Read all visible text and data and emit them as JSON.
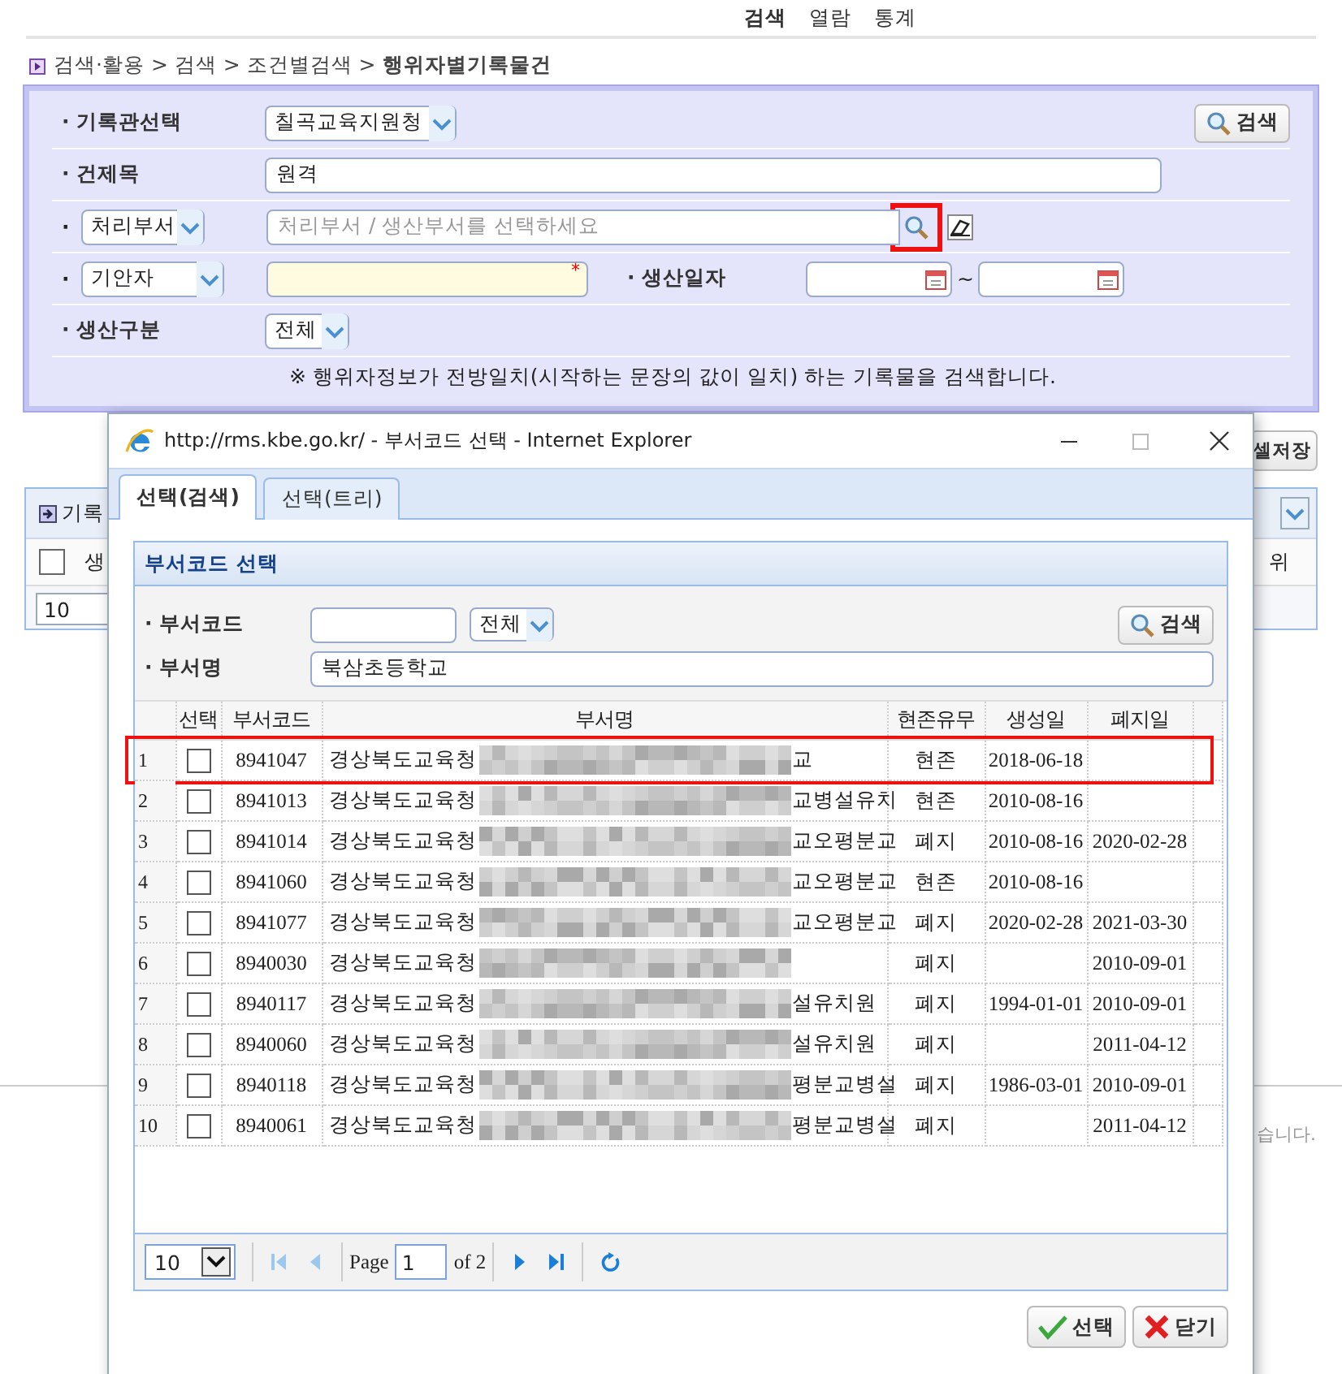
{
  "top_nav": [
    {
      "label": "검색",
      "selected": true
    },
    {
      "label": "열람",
      "selected": false
    },
    {
      "label": "통계",
      "selected": false
    }
  ],
  "breadcrumb": "검색·활용 > 검색 > 조건별검색 > **행위자별기록물건**",
  "search_form": {
    "archive": {
      "label": "· 기록관선택",
      "value": "칠곡교육지원청"
    },
    "search_button": "검색",
    "title": {
      "label": "· 건제목",
      "value": "원격"
    },
    "department": {
      "bullet": "·",
      "type_value": "처리부서",
      "placeholder": "처리부서 / 생산부서를 선택하세요",
      "highlighted": true
    },
    "drafter": {
      "bullet": "·",
      "type_value": "기안자",
      "required_mark": "*"
    },
    "date": {
      "label": "· 생산일자",
      "separator": "~"
    },
    "production_type": {
      "label": "· 생산구분",
      "value": "전체"
    },
    "note": "※ 행위자정보가 전방일치(시작하는 문장의 값이 일치) 하는 기록물을 검색합니다."
  },
  "background": {
    "save_button": "셀저장",
    "panel_title": "기록",
    "select_all_checked": false,
    "column_1": "생",
    "column_last": "위",
    "page_size": "10",
    "footer_text": "습니다."
  },
  "popup": {
    "title": "http://rms.kbe.go.kr/ - 부서코드 선택 - Internet Explorer",
    "tabs": [
      {
        "label": "선택(검색)",
        "selected": true
      },
      {
        "label": "선택(트리)",
        "selected": false
      }
    ],
    "panel_title": "부서코드 선택",
    "code_field": {
      "label": "· 부서코드",
      "scope": "전체"
    },
    "name_field": {
      "label": "· 부서명",
      "value": "북삼초등학교"
    },
    "search_button": "검색",
    "columns": [
      "선택",
      "부서코드",
      "부서명",
      "현존유무",
      "생성일",
      "폐지일"
    ],
    "rows": [
      {
        "no": "1",
        "checked": false,
        "code": "8941047",
        "name_prefix": "경상북도교육청",
        "redacted": true,
        "name_suffix": "교",
        "status": "현존",
        "created": "2018-06-18",
        "highlighted": true
      },
      {
        "no": "2",
        "checked": false,
        "code": "8941013",
        "name_prefix": "경상북도교육청",
        "redacted": true,
        "name_suffix": "교병설유치",
        "status": "현존",
        "created": "2010-08-16",
        "highlighted": false
      },
      {
        "no": "3",
        "checked": false,
        "code": "8941014",
        "name_prefix": "경상북도교육청",
        "redacted": true,
        "name_suffix": "교오평분교",
        "status": "폐지",
        "created": "2010-08-16",
        "closed": "2020-02-28",
        "highlighted": false
      },
      {
        "no": "4",
        "checked": false,
        "code": "8941060",
        "name_prefix": "경상북도교육청",
        "redacted": true,
        "name_suffix": "교오평분교",
        "status": "현존",
        "created": "2010-08-16",
        "highlighted": false
      },
      {
        "no": "5",
        "checked": false,
        "code": "8941077",
        "name_prefix": "경상북도교육청",
        "redacted": true,
        "name_suffix": "교오평분교",
        "status": "폐지",
        "created": "2020-02-28",
        "closed": "2021-03-30",
        "highlighted": false
      },
      {
        "no": "6",
        "checked": false,
        "code": "8940030",
        "name_prefix": "경상북도교육청",
        "redacted": true,
        "status": "폐지",
        "closed": "2010-09-01",
        "highlighted": false
      },
      {
        "no": "7",
        "checked": false,
        "code": "8940117",
        "name_prefix": "경상북도교육청",
        "redacted": true,
        "name_suffix": "설유치원",
        "status": "폐지",
        "created": "1994-01-01",
        "closed": "2010-09-01",
        "highlighted": false
      },
      {
        "no": "8",
        "checked": false,
        "code": "8940060",
        "name_prefix": "경상북도교육청",
        "redacted": true,
        "name_suffix": "설유치원",
        "status": "폐지",
        "closed": "2011-04-12",
        "highlighted": false
      },
      {
        "no": "9",
        "checked": false,
        "code": "8940118",
        "name_prefix": "경상북도교육청",
        "redacted": true,
        "name_suffix": "평분교병설",
        "status": "폐지",
        "created": "1986-03-01",
        "closed": "2010-09-01",
        "highlighted": false
      },
      {
        "no": "10",
        "checked": false,
        "code": "8940061",
        "name_prefix": "경상북도교육청",
        "redacted": true,
        "name_suffix": "평분교병설",
        "status": "폐지",
        "closed": "2011-04-12",
        "highlighted": false
      }
    ],
    "pager": {
      "page_size": "10",
      "page_label": "Page",
      "page": "1",
      "of": "of 2"
    },
    "buttons": [
      {
        "kind": "confirm",
        "label": "선택"
      },
      {
        "kind": "close",
        "label": "닫기"
      }
    ]
  }
}
